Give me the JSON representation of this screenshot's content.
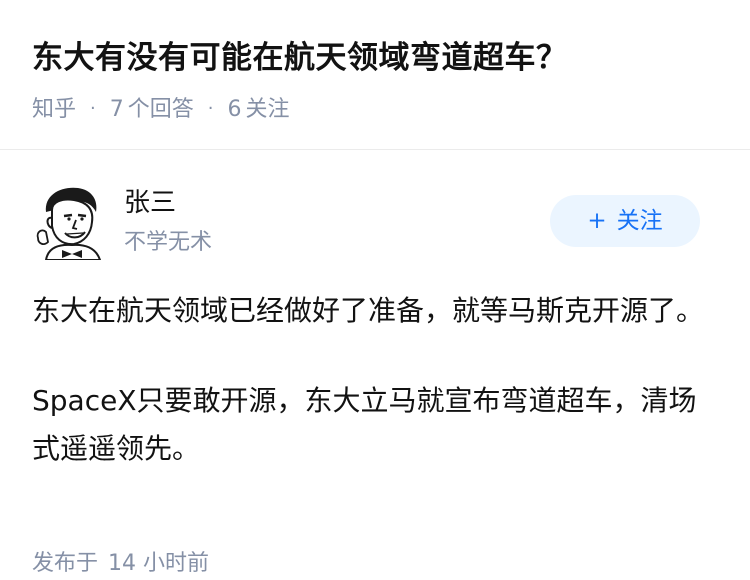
{
  "question": {
    "title": "东大有没有可能在航天领域弯道超车？",
    "source": "知乎",
    "answer_count": "7",
    "answer_label": "个回答",
    "follower_count": "6",
    "follower_label": "关注"
  },
  "answer": {
    "author": {
      "name": "张三",
      "bio": "不学无术",
      "avatar_icon": "meme-man-avatar-icon"
    },
    "follow_button": {
      "icon": "+",
      "label": "关注"
    },
    "paragraphs": [
      "东大在航天领域已经做好了准备，就等马斯克开源了。",
      "SpaceX只要敢开源，东大立马就宣布弯道超车，清场式遥遥领先。"
    ],
    "published_label": "发布于",
    "published_time": "14 小时前"
  },
  "colors": {
    "text": "#121212",
    "meta": "#8590a6",
    "accent": "#1772f6",
    "button_bg": "#ebf5ff",
    "divider": "#ebebeb"
  }
}
